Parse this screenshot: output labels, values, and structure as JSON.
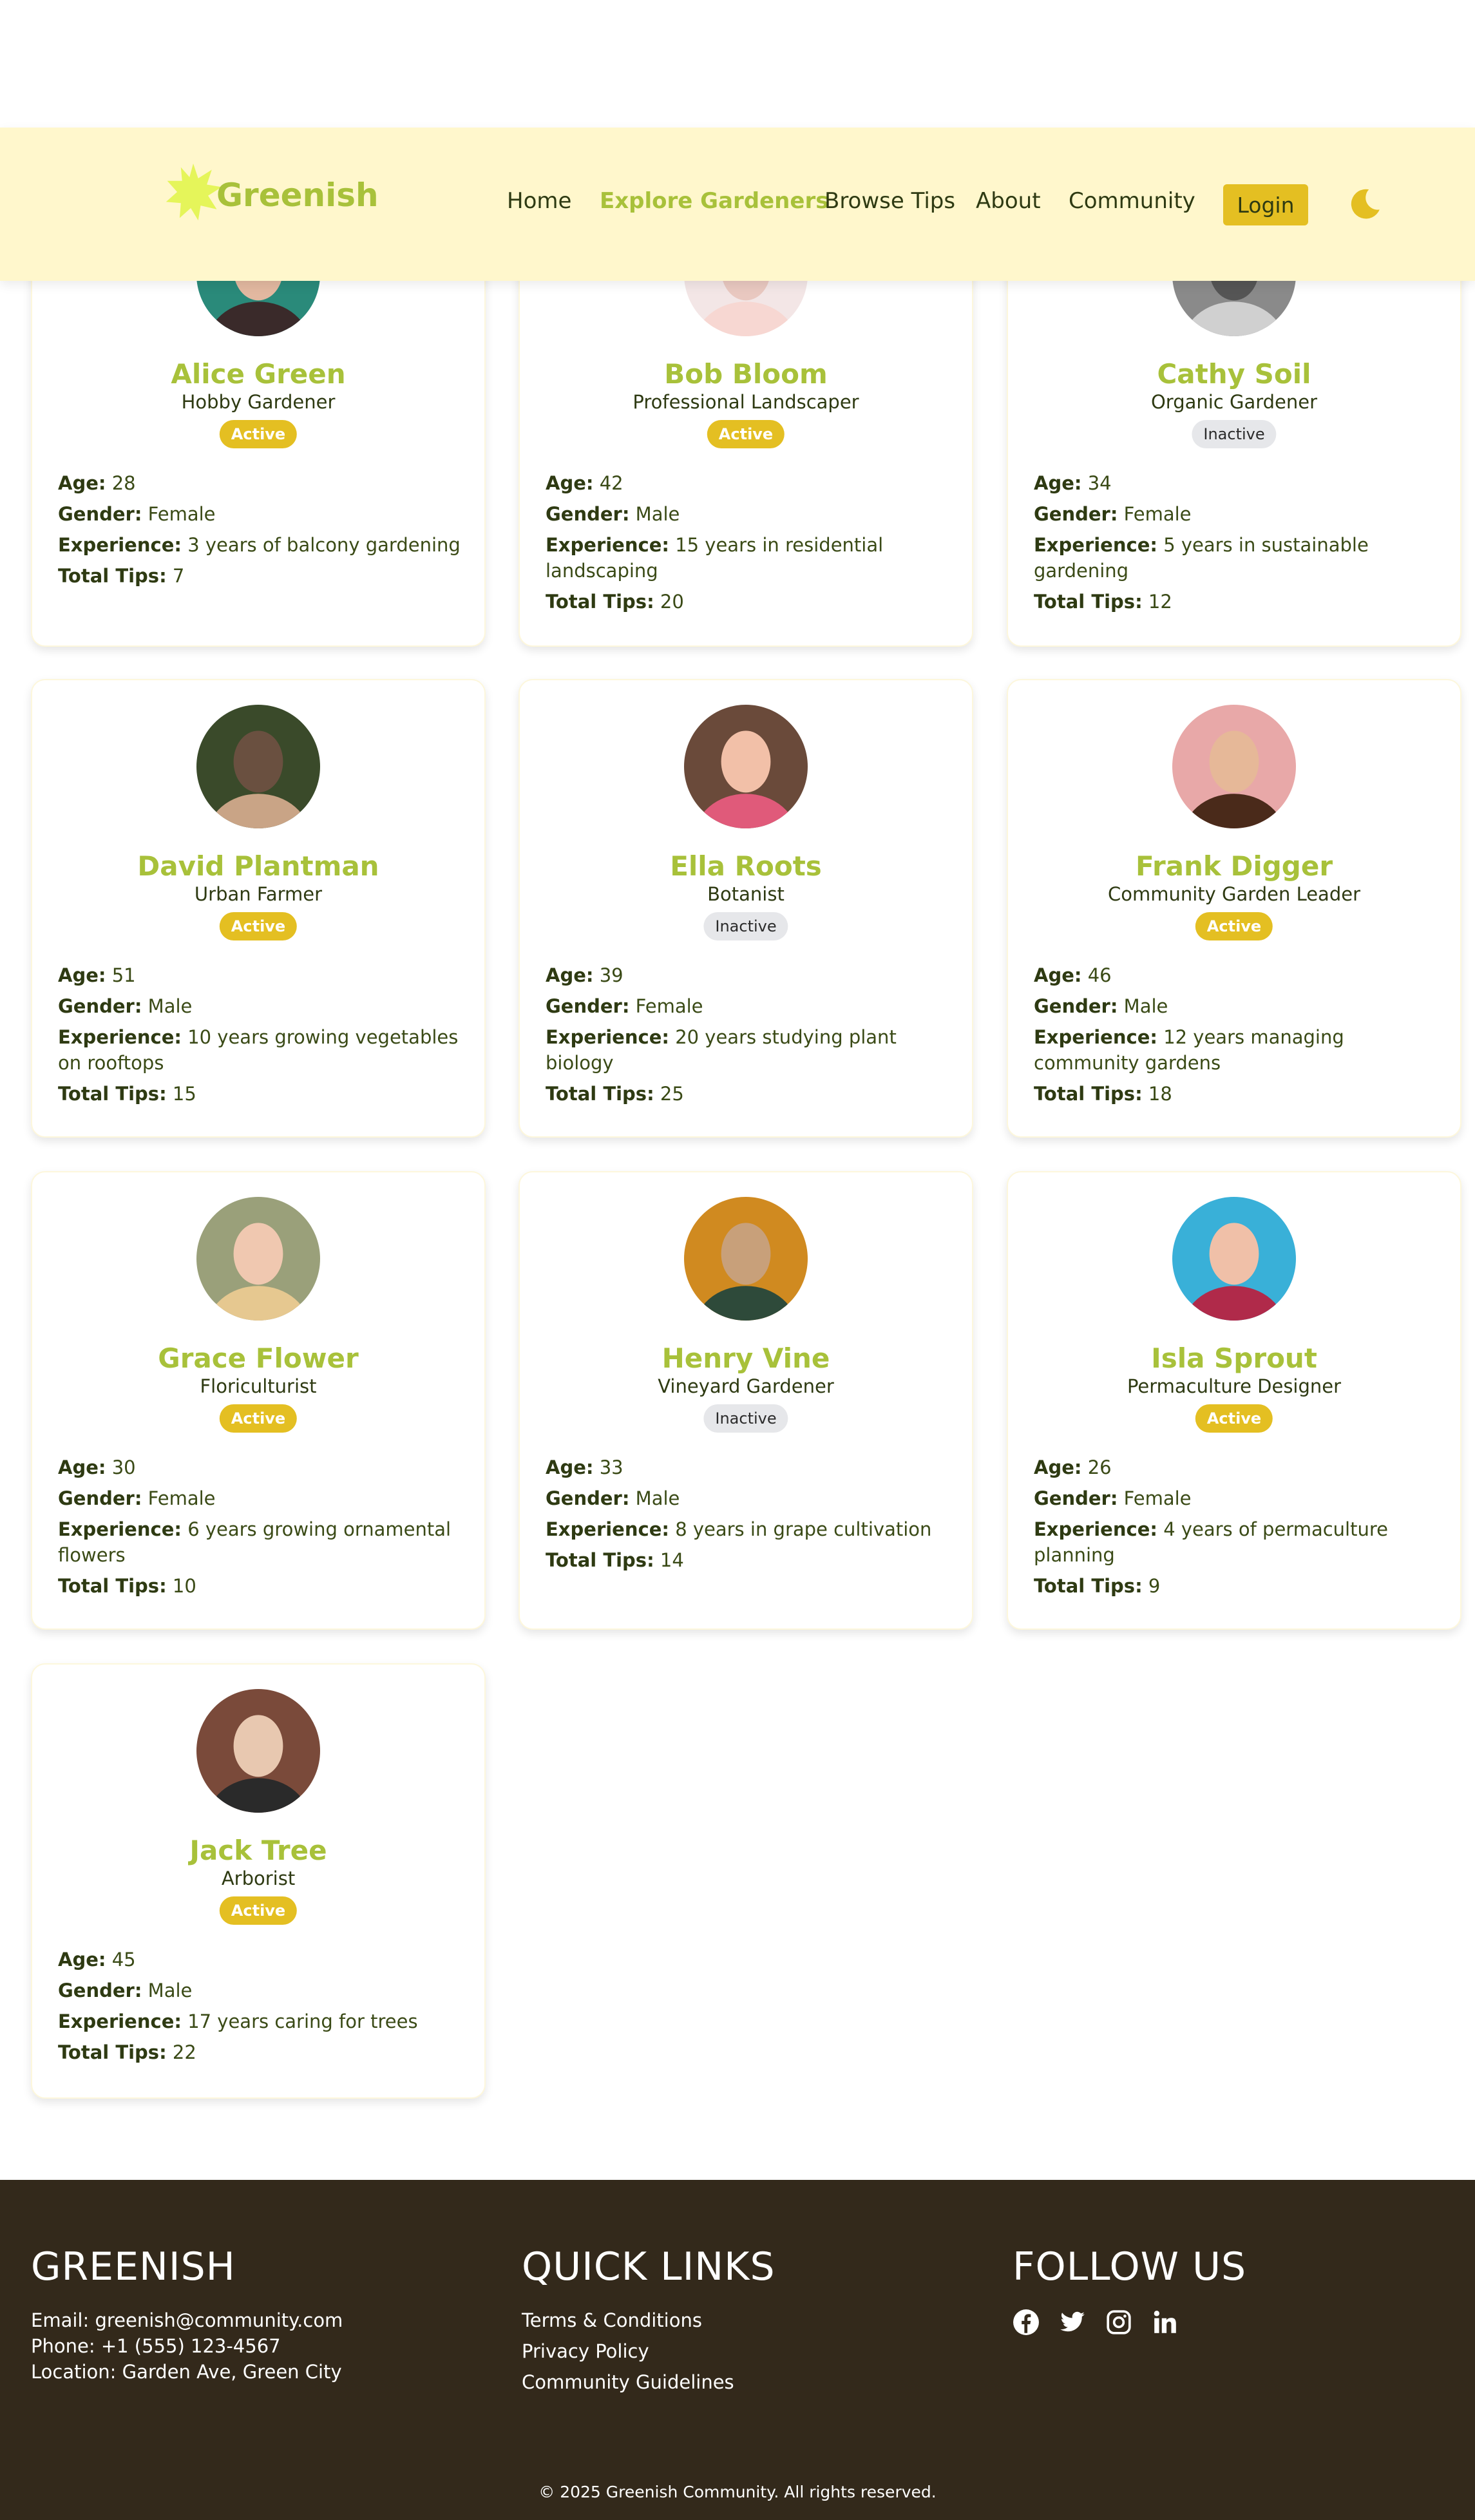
{
  "header": {
    "logo_text": "Greenish",
    "nav": [
      {
        "label": "Home",
        "active": false
      },
      {
        "label": "Explore Gardeners",
        "active": true
      },
      {
        "label": "Browse Tips",
        "active": false
      },
      {
        "label": "About",
        "active": false
      },
      {
        "label": "Community",
        "active": false
      }
    ],
    "login_label": "Login"
  },
  "labels": {
    "age": "Age:",
    "gender": "Gender:",
    "experience": "Experience:",
    "total_tips": "Total Tips:"
  },
  "gardeners": [
    {
      "name": "Alice Green",
      "role": "Hobby Gardener",
      "status": "Active",
      "age": "28",
      "gender": "Female",
      "experience": "3 years of balcony gardening",
      "tips": "7"
    },
    {
      "name": "Bob Bloom",
      "role": "Professional Landscaper",
      "status": "Active",
      "age": "42",
      "gender": "Male",
      "experience": "15 years in residential landscaping",
      "tips": "20"
    },
    {
      "name": "Cathy Soil",
      "role": "Organic Gardener",
      "status": "Inactive",
      "age": "34",
      "gender": "Female",
      "experience": "5 years in sustainable gardening",
      "tips": "12"
    },
    {
      "name": "David Plantman",
      "role": "Urban Farmer",
      "status": "Active",
      "age": "51",
      "gender": "Male",
      "experience": "10 years growing vegetables on rooftops",
      "tips": "15"
    },
    {
      "name": "Ella Roots",
      "role": "Botanist",
      "status": "Inactive",
      "age": "39",
      "gender": "Female",
      "experience": "20 years studying plant biology",
      "tips": "25"
    },
    {
      "name": "Frank Digger",
      "role": "Community Garden Leader",
      "status": "Active",
      "age": "46",
      "gender": "Male",
      "experience": "12 years managing community gardens",
      "tips": "18"
    },
    {
      "name": "Grace Flower",
      "role": "Floriculturist",
      "status": "Active",
      "age": "30",
      "gender": "Female",
      "experience": "6 years growing ornamental flowers",
      "tips": "10"
    },
    {
      "name": "Henry Vine",
      "role": "Vineyard Gardener",
      "status": "Inactive",
      "age": "33",
      "gender": "Male",
      "experience": "8 years in grape cultivation",
      "tips": "14"
    },
    {
      "name": "Isla Sprout",
      "role": "Permaculture Designer",
      "status": "Active",
      "age": "26",
      "gender": "Female",
      "experience": "4 years of permaculture planning",
      "tips": "9"
    },
    {
      "name": "Jack Tree",
      "role": "Arborist",
      "status": "Active",
      "age": "45",
      "gender": "Male",
      "experience": "17 years caring for trees",
      "tips": "22"
    }
  ],
  "footer": {
    "brand_title": "GREENISH",
    "email": "Email: greenish@community.com",
    "phone": "Phone: +1 (555) 123-4567",
    "location": "Location: Garden Ave, Green City",
    "links_title": "QUICK LINKS",
    "links": [
      "Terms & Conditions",
      "Privacy Policy",
      "Community Guidelines"
    ],
    "follow_title": "FOLLOW US",
    "social_icons": [
      "facebook-icon",
      "twitter-icon",
      "instagram-icon",
      "linkedin-icon"
    ],
    "copyright": "© 2025 Greenish Community. All rights reserved."
  },
  "colors": {
    "accent_green": "#a8c13a",
    "accent_yellow": "#e4bf22",
    "header_bg": "#fff7cc",
    "footer_bg": "#33291b",
    "text_dark_green": "#2e3a12"
  }
}
